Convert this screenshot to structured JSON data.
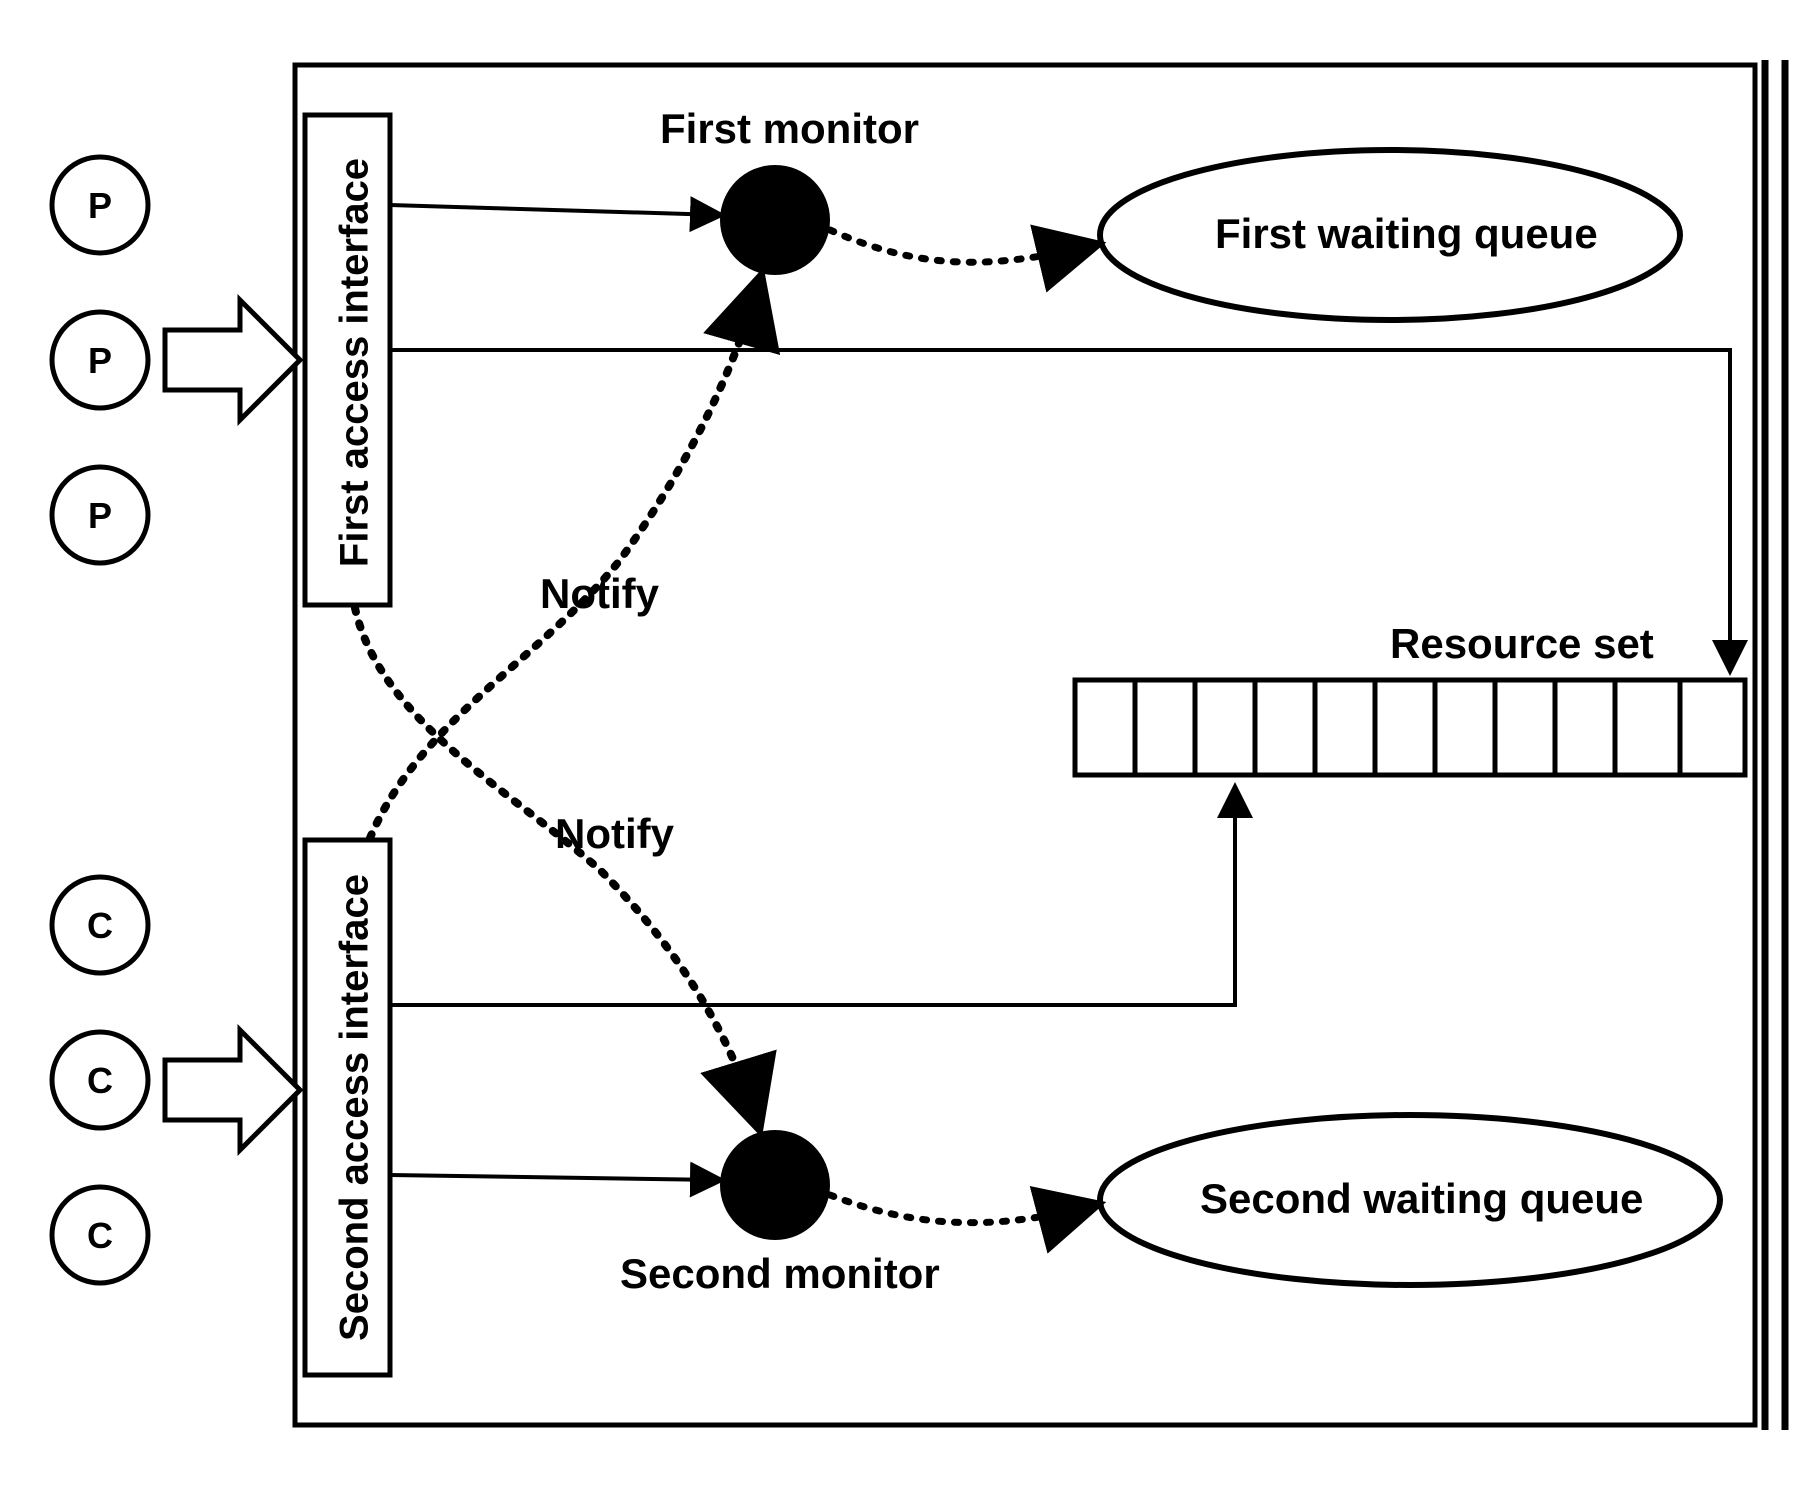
{
  "actors": {
    "producers": [
      "P",
      "P",
      "P"
    ],
    "consumers": [
      "C",
      "C",
      "C"
    ]
  },
  "interfaces": {
    "first": "First  access interface",
    "second": "Second access interface"
  },
  "monitors": {
    "first": "First monitor",
    "second": "Second monitor"
  },
  "queues": {
    "first": "First waiting queue",
    "second": "Second waiting queue"
  },
  "resource": "Resource set",
  "notify": "Notify"
}
